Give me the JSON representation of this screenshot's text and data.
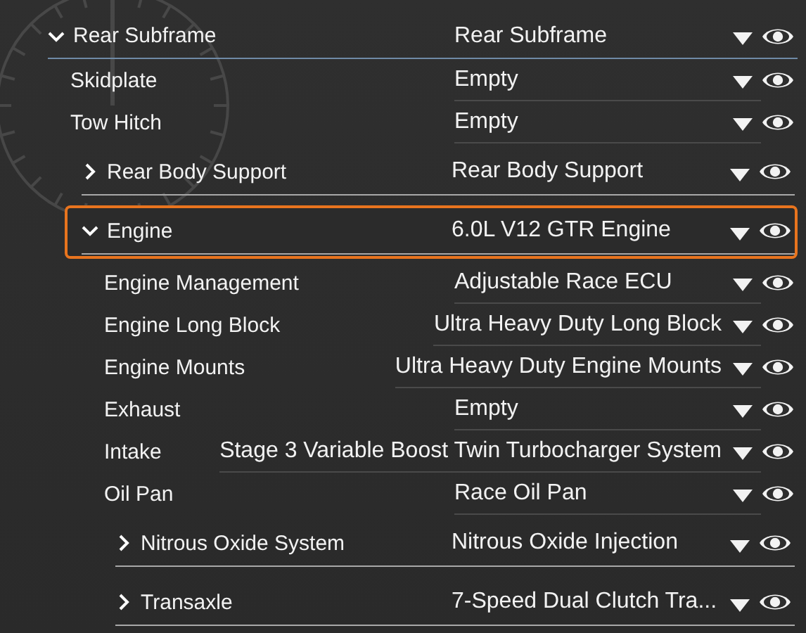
{
  "parts": [
    {
      "kind": "group",
      "label": "Rear Subframe",
      "value": "Rear Subframe",
      "expanded": true,
      "selected": false,
      "children": [
        {
          "kind": "leaf",
          "label": "Skidplate",
          "value": "Empty",
          "selected": false
        },
        {
          "kind": "leaf",
          "label": "Tow Hitch",
          "value": "Empty",
          "selected": false
        },
        {
          "kind": "group",
          "label": "Rear Body Support",
          "value": "Rear Body Support",
          "expanded": false,
          "selected": false
        },
        {
          "kind": "group",
          "label": "Engine",
          "value": "6.0L V12 GTR Engine",
          "expanded": true,
          "selected": true,
          "children": [
            {
              "kind": "leaf",
              "label": "Engine Management",
              "value": "Adjustable Race ECU",
              "selected": false
            },
            {
              "kind": "leaf",
              "label": "Engine Long Block",
              "value": "Ultra Heavy Duty Long Block",
              "selected": false
            },
            {
              "kind": "leaf",
              "label": "Engine Mounts",
              "value": "Ultra Heavy Duty Engine Mounts",
              "selected": false
            },
            {
              "kind": "leaf",
              "label": "Exhaust",
              "value": "Empty",
              "selected": false
            },
            {
              "kind": "leaf",
              "label": "Intake",
              "value": "Stage 3 Variable Boost Twin Turbocharger System",
              "selected": false
            },
            {
              "kind": "leaf",
              "label": "Oil Pan",
              "value": "Race Oil Pan",
              "selected": false
            },
            {
              "kind": "group",
              "label": "Nitrous Oxide System",
              "value": "Nitrous Oxide Injection",
              "expanded": false,
              "selected": false
            },
            {
              "kind": "group",
              "label": "Transaxle",
              "value": "7-Speed Dual Clutch Tra...",
              "expanded": false,
              "selected": false
            }
          ]
        }
      ]
    }
  ]
}
